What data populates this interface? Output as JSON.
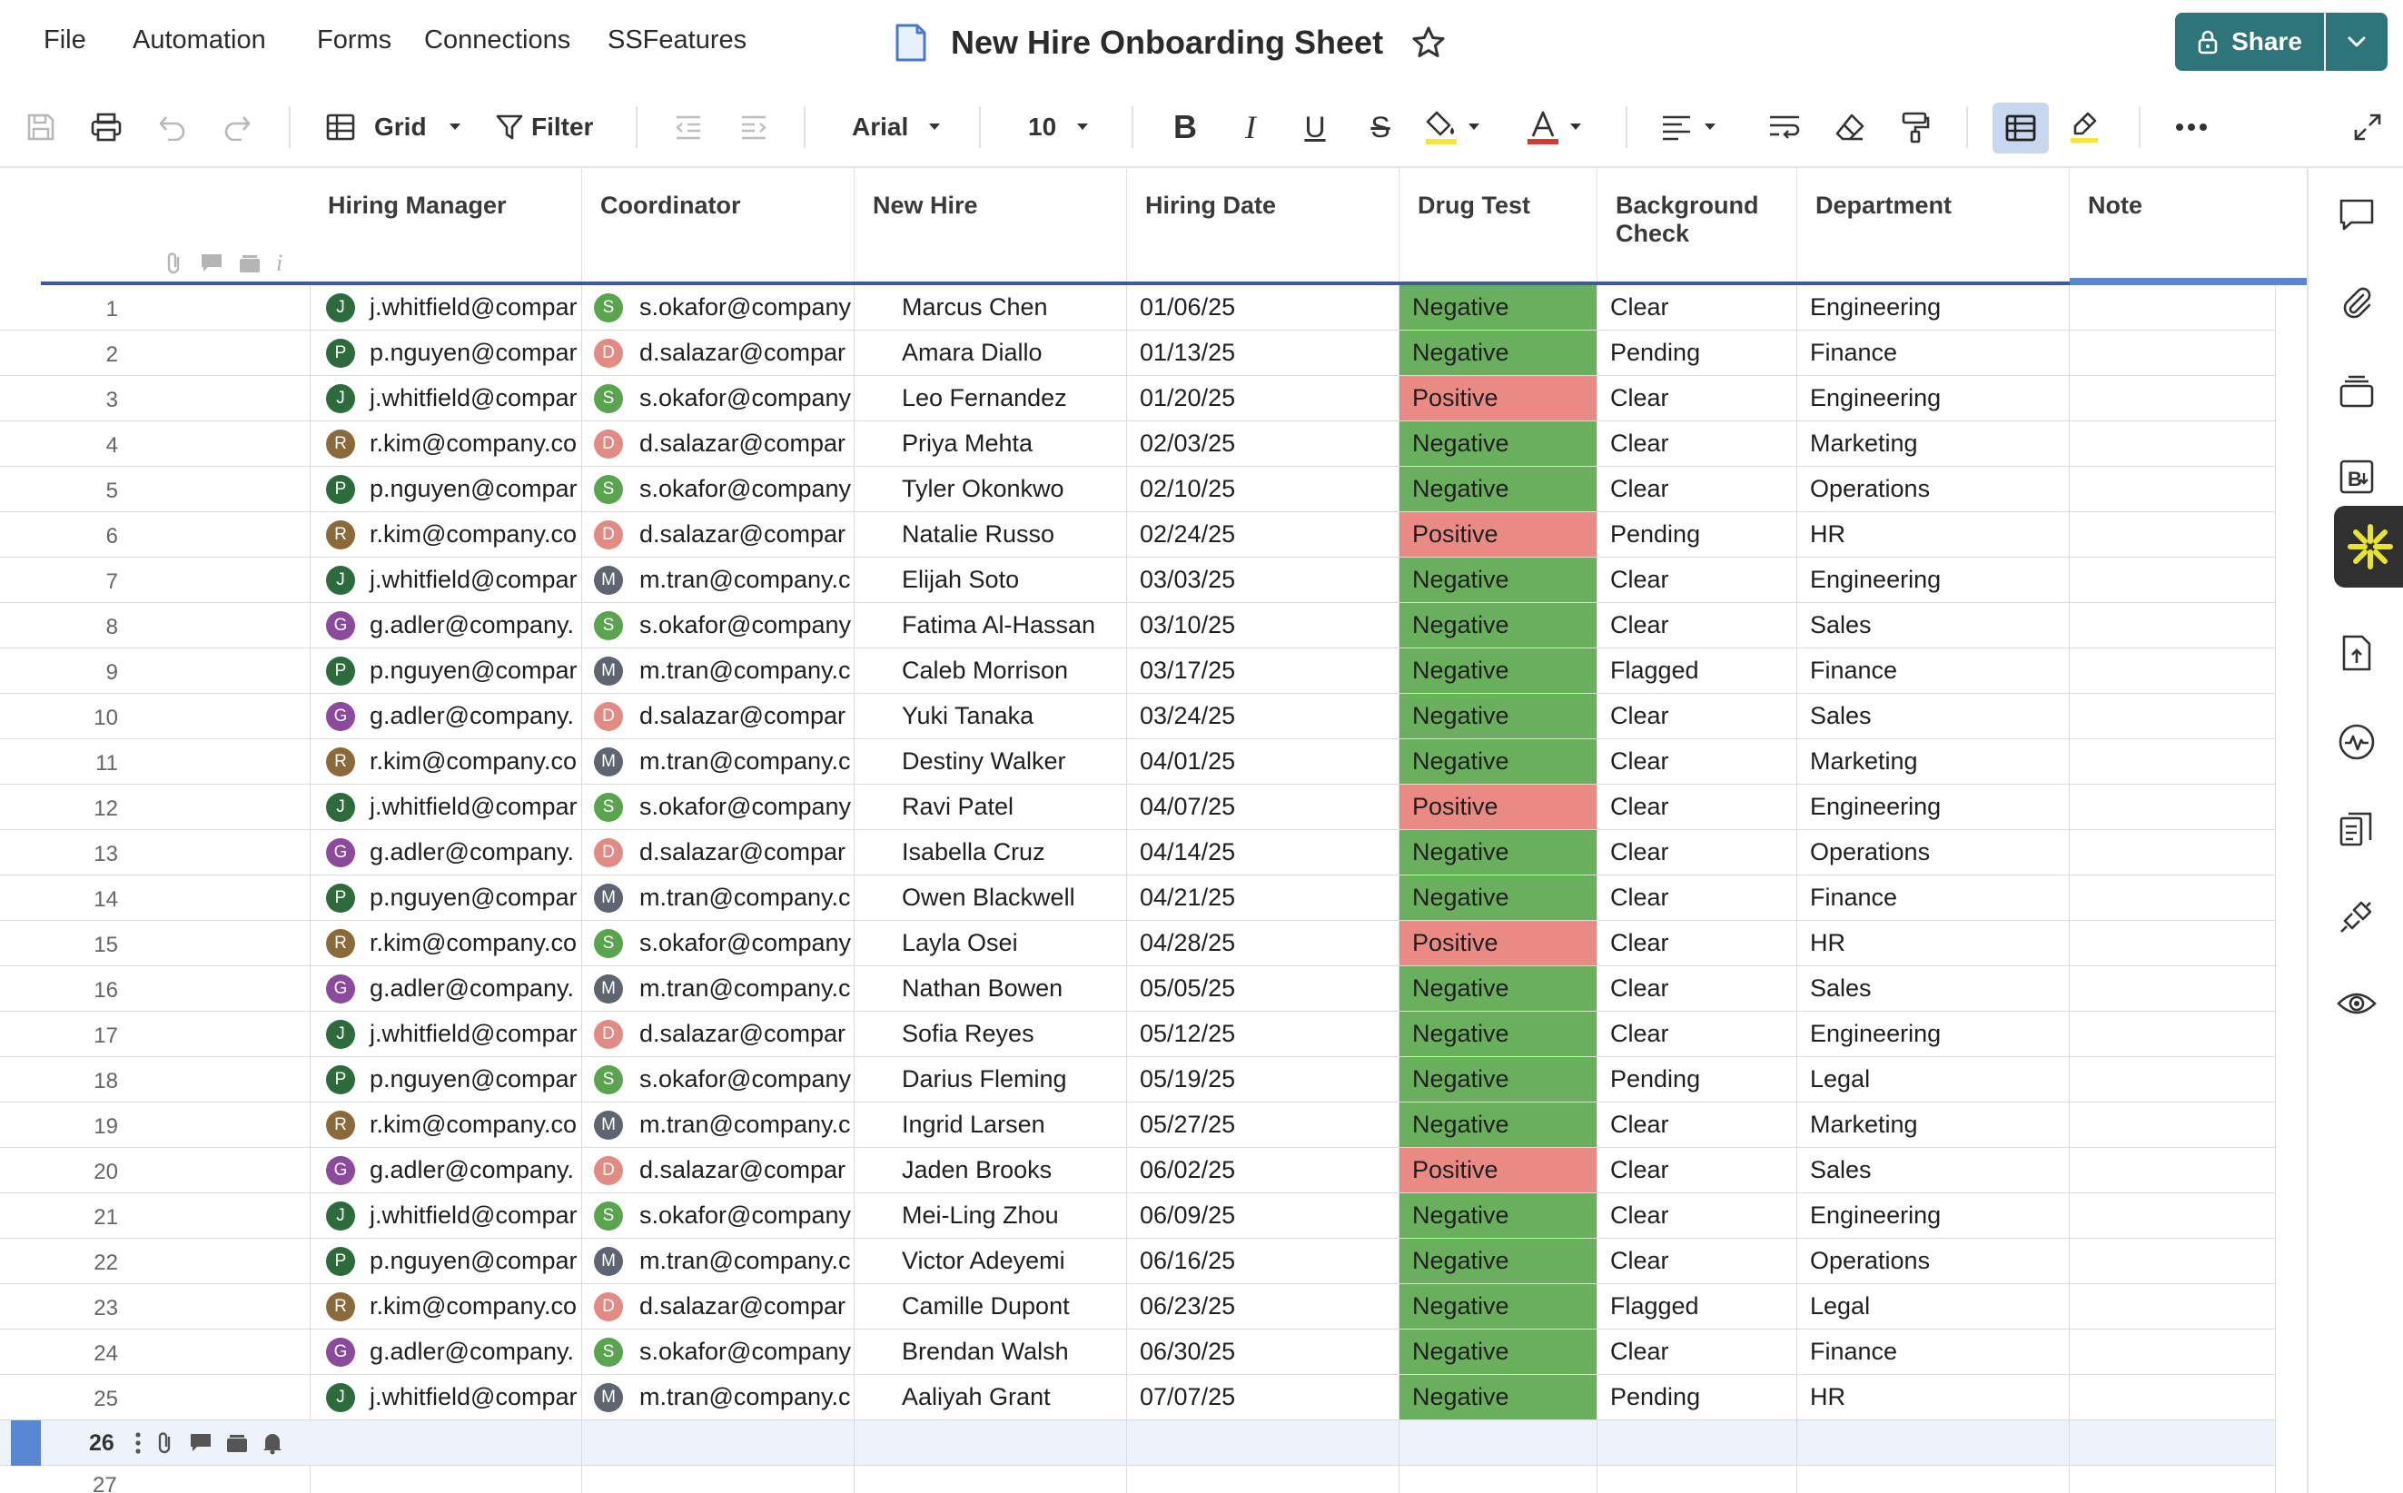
{
  "menu": {
    "items": [
      "File",
      "Automation",
      "Forms",
      "Connections",
      "SSFeatures"
    ],
    "sheet_title": "New Hire Onboarding Sheet",
    "share_label": "Share"
  },
  "toolbar": {
    "view_label": "Grid",
    "filter_label": "Filter",
    "font_name": "Arial",
    "font_size": "10"
  },
  "columns": {
    "hiring_manager": "Hiring Manager",
    "coordinator": "Coordinator",
    "new_hire": "New Hire",
    "hiring_date": "Hiring Date",
    "drug_test": "Drug Test",
    "background_check": "Background Check",
    "department": "Department",
    "note": "Note"
  },
  "colors": {
    "negative": "#6aaf5d",
    "positive": "#ea8a85",
    "accent": "#2f7478",
    "header_line": "#3d5a9e",
    "active_blue": "#5a87d2"
  },
  "people": {
    "J": "#2e6b3c",
    "P": "#2e6b3c",
    "R": "#8a6a3a",
    "G": "#8b4a9c",
    "S": "#5aa34f",
    "D": "#e28a84",
    "M": "#5e6470"
  },
  "rows": [
    {
      "num": "1",
      "mgr": "j.whitfield@compar",
      "mgr_i": "J",
      "coord": "s.okafor@company",
      "coord_i": "S",
      "hire": "Marcus Chen",
      "date": "01/06/25",
      "drug": "Negative",
      "bg": "Clear",
      "dept": "Engineering"
    },
    {
      "num": "2",
      "mgr": "p.nguyen@compar",
      "mgr_i": "P",
      "coord": "d.salazar@compar",
      "coord_i": "D",
      "hire": "Amara Diallo",
      "date": "01/13/25",
      "drug": "Negative",
      "bg": "Pending",
      "dept": "Finance"
    },
    {
      "num": "3",
      "mgr": "j.whitfield@compar",
      "mgr_i": "J",
      "coord": "s.okafor@company",
      "coord_i": "S",
      "hire": "Leo Fernandez",
      "date": "01/20/25",
      "drug": "Positive",
      "bg": "Clear",
      "dept": "Engineering"
    },
    {
      "num": "4",
      "mgr": "r.kim@company.co",
      "mgr_i": "R",
      "coord": "d.salazar@compar",
      "coord_i": "D",
      "hire": "Priya Mehta",
      "date": "02/03/25",
      "drug": "Negative",
      "bg": "Clear",
      "dept": "Marketing"
    },
    {
      "num": "5",
      "mgr": "p.nguyen@compar",
      "mgr_i": "P",
      "coord": "s.okafor@company",
      "coord_i": "S",
      "hire": "Tyler Okonkwo",
      "date": "02/10/25",
      "drug": "Negative",
      "bg": "Clear",
      "dept": "Operations"
    },
    {
      "num": "6",
      "mgr": "r.kim@company.co",
      "mgr_i": "R",
      "coord": "d.salazar@compar",
      "coord_i": "D",
      "hire": "Natalie Russo",
      "date": "02/24/25",
      "drug": "Positive",
      "bg": "Pending",
      "dept": "HR"
    },
    {
      "num": "7",
      "mgr": "j.whitfield@compar",
      "mgr_i": "J",
      "coord": "m.tran@company.c",
      "coord_i": "M",
      "hire": "Elijah Soto",
      "date": "03/03/25",
      "drug": "Negative",
      "bg": "Clear",
      "dept": "Engineering"
    },
    {
      "num": "8",
      "mgr": "g.adler@company.",
      "mgr_i": "G",
      "coord": "s.okafor@company",
      "coord_i": "S",
      "hire": "Fatima Al-Hassan",
      "date": "03/10/25",
      "drug": "Negative",
      "bg": "Clear",
      "dept": "Sales"
    },
    {
      "num": "9",
      "mgr": "p.nguyen@compar",
      "mgr_i": "P",
      "coord": "m.tran@company.c",
      "coord_i": "M",
      "hire": "Caleb Morrison",
      "date": "03/17/25",
      "drug": "Negative",
      "bg": "Flagged",
      "dept": "Finance"
    },
    {
      "num": "10",
      "mgr": "g.adler@company.",
      "mgr_i": "G",
      "coord": "d.salazar@compar",
      "coord_i": "D",
      "hire": "Yuki Tanaka",
      "date": "03/24/25",
      "drug": "Negative",
      "bg": "Clear",
      "dept": "Sales"
    },
    {
      "num": "11",
      "mgr": "r.kim@company.co",
      "mgr_i": "R",
      "coord": "m.tran@company.c",
      "coord_i": "M",
      "hire": "Destiny Walker",
      "date": "04/01/25",
      "drug": "Negative",
      "bg": "Clear",
      "dept": "Marketing"
    },
    {
      "num": "12",
      "mgr": "j.whitfield@compar",
      "mgr_i": "J",
      "coord": "s.okafor@company",
      "coord_i": "S",
      "hire": "Ravi Patel",
      "date": "04/07/25",
      "drug": "Positive",
      "bg": "Clear",
      "dept": "Engineering"
    },
    {
      "num": "13",
      "mgr": "g.adler@company.",
      "mgr_i": "G",
      "coord": "d.salazar@compar",
      "coord_i": "D",
      "hire": "Isabella Cruz",
      "date": "04/14/25",
      "drug": "Negative",
      "bg": "Clear",
      "dept": "Operations"
    },
    {
      "num": "14",
      "mgr": "p.nguyen@compar",
      "mgr_i": "P",
      "coord": "m.tran@company.c",
      "coord_i": "M",
      "hire": "Owen Blackwell",
      "date": "04/21/25",
      "drug": "Negative",
      "bg": "Clear",
      "dept": "Finance"
    },
    {
      "num": "15",
      "mgr": "r.kim@company.co",
      "mgr_i": "R",
      "coord": "s.okafor@company",
      "coord_i": "S",
      "hire": "Layla Osei",
      "date": "04/28/25",
      "drug": "Positive",
      "bg": "Clear",
      "dept": "HR"
    },
    {
      "num": "16",
      "mgr": "g.adler@company.",
      "mgr_i": "G",
      "coord": "m.tran@company.c",
      "coord_i": "M",
      "hire": "Nathan Bowen",
      "date": "05/05/25",
      "drug": "Negative",
      "bg": "Clear",
      "dept": "Sales"
    },
    {
      "num": "17",
      "mgr": "j.whitfield@compar",
      "mgr_i": "J",
      "coord": "d.salazar@compar",
      "coord_i": "D",
      "hire": "Sofia Reyes",
      "date": "05/12/25",
      "drug": "Negative",
      "bg": "Clear",
      "dept": "Engineering"
    },
    {
      "num": "18",
      "mgr": "p.nguyen@compar",
      "mgr_i": "P",
      "coord": "s.okafor@company",
      "coord_i": "S",
      "hire": "Darius Fleming",
      "date": "05/19/25",
      "drug": "Negative",
      "bg": "Pending",
      "dept": "Legal"
    },
    {
      "num": "19",
      "mgr": "r.kim@company.co",
      "mgr_i": "R",
      "coord": "m.tran@company.c",
      "coord_i": "M",
      "hire": "Ingrid Larsen",
      "date": "05/27/25",
      "drug": "Negative",
      "bg": "Clear",
      "dept": "Marketing"
    },
    {
      "num": "20",
      "mgr": "g.adler@company.",
      "mgr_i": "G",
      "coord": "d.salazar@compar",
      "coord_i": "D",
      "hire": "Jaden Brooks",
      "date": "06/02/25",
      "drug": "Positive",
      "bg": "Clear",
      "dept": "Sales"
    },
    {
      "num": "21",
      "mgr": "j.whitfield@compar",
      "mgr_i": "J",
      "coord": "s.okafor@company",
      "coord_i": "S",
      "hire": "Mei-Ling Zhou",
      "date": "06/09/25",
      "drug": "Negative",
      "bg": "Clear",
      "dept": "Engineering"
    },
    {
      "num": "22",
      "mgr": "p.nguyen@compar",
      "mgr_i": "P",
      "coord": "m.tran@company.c",
      "coord_i": "M",
      "hire": "Victor Adeyemi",
      "date": "06/16/25",
      "drug": "Negative",
      "bg": "Clear",
      "dept": "Operations"
    },
    {
      "num": "23",
      "mgr": "r.kim@company.co",
      "mgr_i": "R",
      "coord": "d.salazar@compar",
      "coord_i": "D",
      "hire": "Camille Dupont",
      "date": "06/23/25",
      "drug": "Negative",
      "bg": "Flagged",
      "dept": "Legal"
    },
    {
      "num": "24",
      "mgr": "g.adler@company.",
      "mgr_i": "G",
      "coord": "s.okafor@company",
      "coord_i": "S",
      "hire": "Brendan Walsh",
      "date": "06/30/25",
      "drug": "Negative",
      "bg": "Clear",
      "dept": "Finance"
    },
    {
      "num": "25",
      "mgr": "j.whitfield@compar",
      "mgr_i": "J",
      "coord": "m.tran@company.c",
      "coord_i": "M",
      "hire": "Aaliyah Grant",
      "date": "07/07/25",
      "drug": "Negative",
      "bg": "Pending",
      "dept": "HR"
    }
  ],
  "new_row_num": "26",
  "next_row_num": "27"
}
